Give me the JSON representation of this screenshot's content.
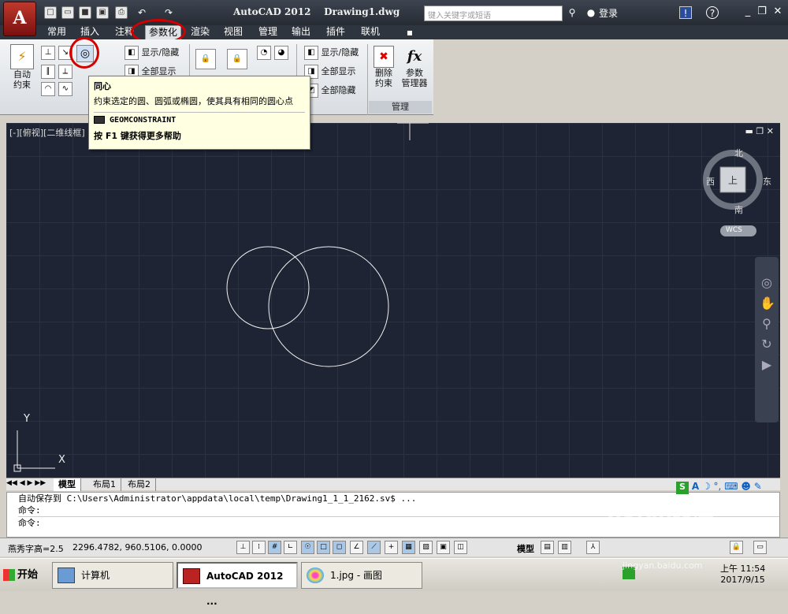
{
  "window": {
    "title": "AutoCAD 2012    Drawing1.dwg",
    "search_placeholder": "键入关键字或短语",
    "login": "登录",
    "help_icon": "?"
  },
  "ribbon_tabs": [
    "常用",
    "插入",
    "注释",
    "参数化",
    "渲染",
    "视图",
    "管理",
    "输出",
    "插件",
    "联机"
  ],
  "active_tab": "参数化",
  "ribbon": {
    "auto_constrain": "自动\n约束",
    "show_hide_1": "显示/隐藏",
    "show_all_1": "全部显示",
    "show_hide_2": "显示/隐藏",
    "show_all_2": "全部显示",
    "hide_all_2": "全部隐藏",
    "delete_constraints": "删除\n约束",
    "parameters_manager": "参数\n管理器",
    "panel_manage": "管理"
  },
  "tooltip": {
    "title": "同心",
    "description": "约束选定的圆、圆弧或椭圆，使其具有相同的圆心点",
    "command": "GEOMCONSTRAINT",
    "help": "按 F1 键获得更多帮助"
  },
  "viewport": {
    "label": "[-][俯视][二维线框]",
    "compass": {
      "north": "北",
      "south": "南",
      "east": "东",
      "west": "西",
      "center": "上",
      "wcs": "WCS"
    },
    "ucs_y": "Y",
    "ucs_x": "X"
  },
  "layout_tabs": [
    "模型",
    "布局1",
    "布局2"
  ],
  "command_window": {
    "line1": "自动保存到 C:\\Users\\Administrator\\appdata\\local\\temp\\Drawing1_1_1_2162.sv$ ...",
    "line2": "命令:",
    "line3": "命令:"
  },
  "status_bar": {
    "text_style": "燕秀字高=2.5",
    "coordinates": "2296.4782, 960.5106, 0.0000",
    "model": "模型"
  },
  "taskbar": {
    "start": "开始",
    "tasks": [
      "计算机",
      "AutoCAD 2012 ...",
      "1.jpg - 画图"
    ],
    "time": "上午 11:54",
    "date": "2017/9/15"
  },
  "watermark": "Baidu经验 jingyan.baidu.com",
  "colors": {
    "viewport_bg": "#1e2433",
    "highlight": "#d40000",
    "tooltip_bg": "#ffffe1"
  }
}
